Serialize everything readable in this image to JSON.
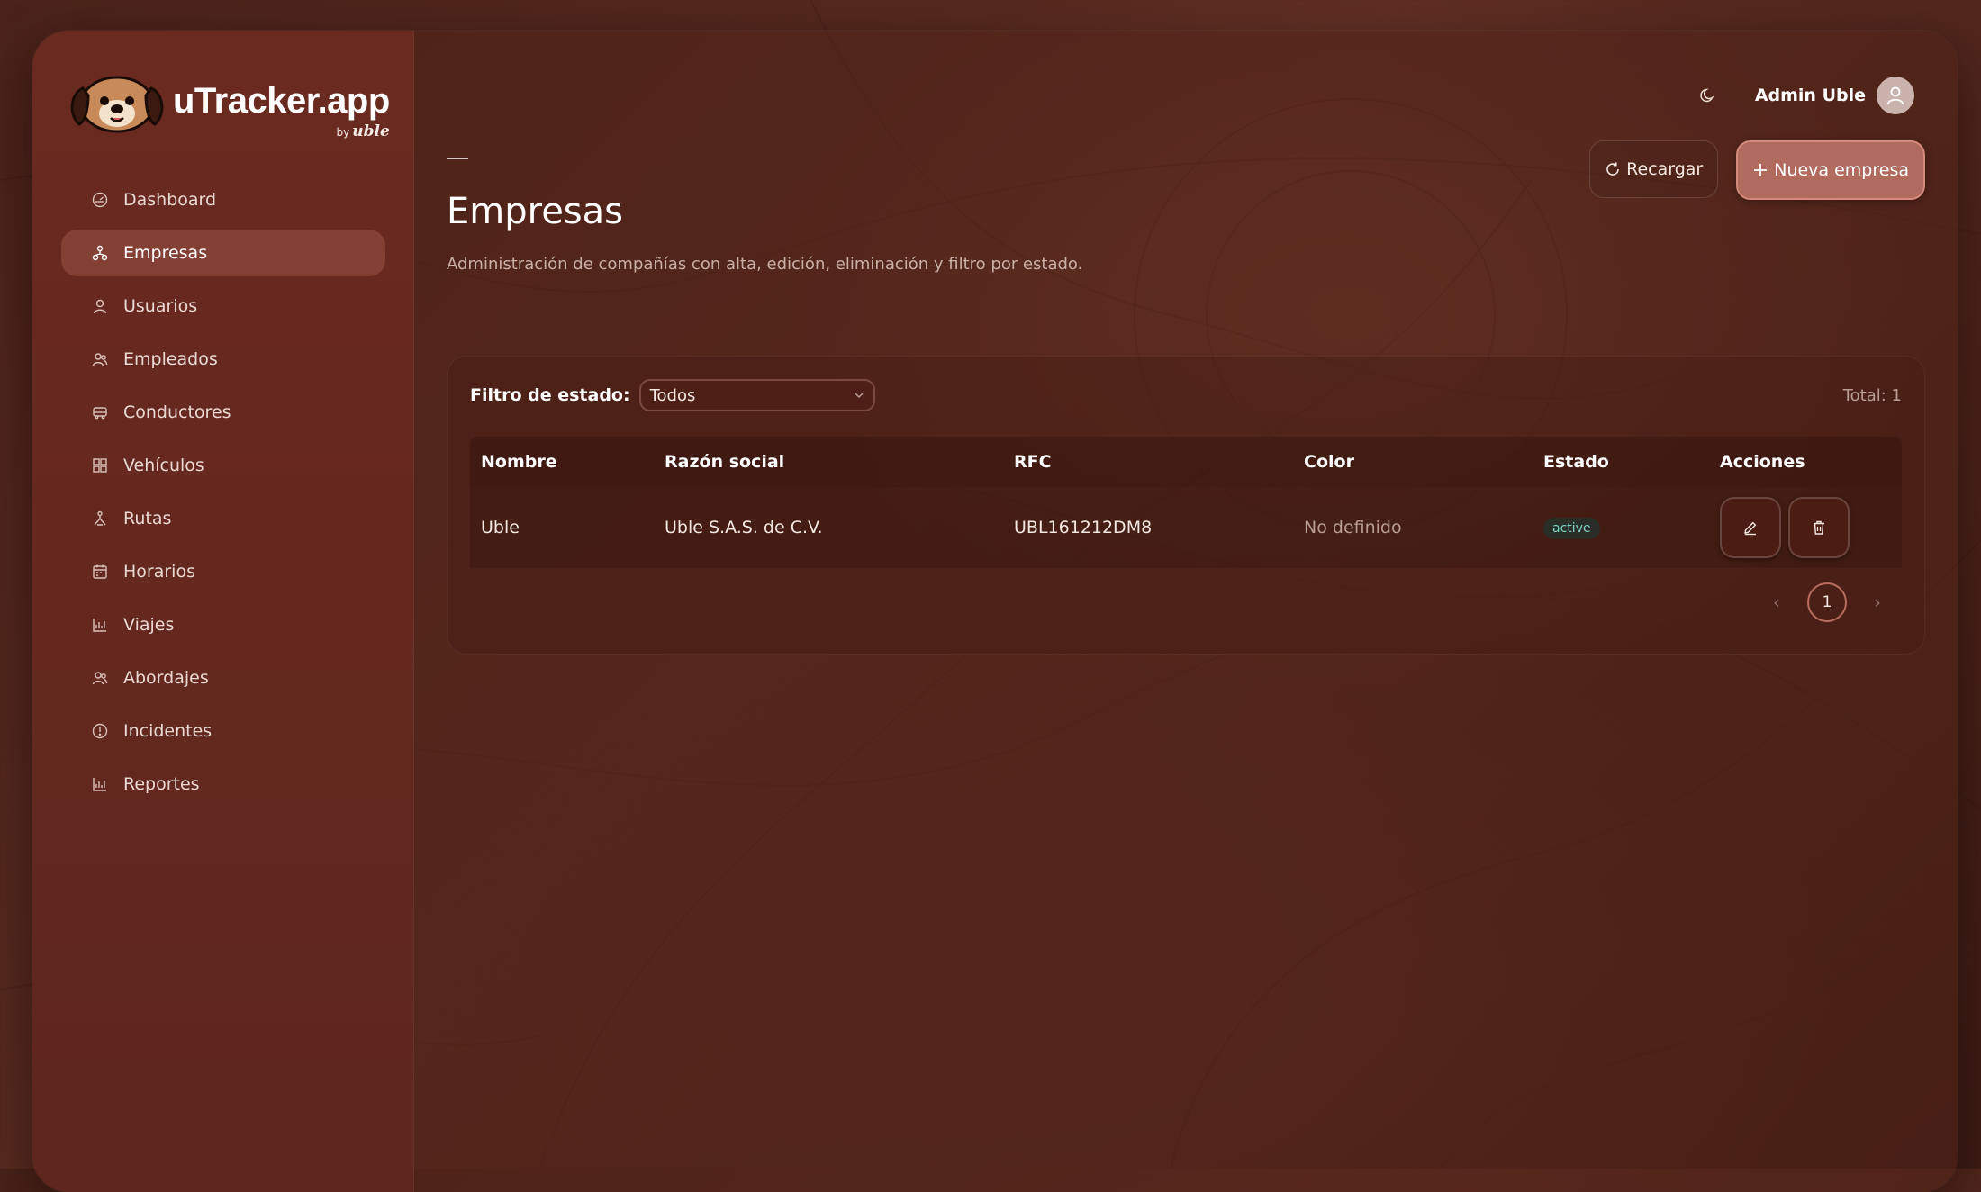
{
  "brand": {
    "name": "uTracker.app",
    "by": "by",
    "by_brand": "uble"
  },
  "header": {
    "user_name": "Admin Uble"
  },
  "sidebar": {
    "items": [
      {
        "label": "Dashboard",
        "icon": "dashboard-icon"
      },
      {
        "label": "Empresas",
        "icon": "buildings-icon",
        "active": true
      },
      {
        "label": "Usuarios",
        "icon": "user-icon"
      },
      {
        "label": "Empleados",
        "icon": "users-icon"
      },
      {
        "label": "Conductores",
        "icon": "car-icon"
      },
      {
        "label": "Vehículos",
        "icon": "grid-icon"
      },
      {
        "label": "Rutas",
        "icon": "route-icon"
      },
      {
        "label": "Horarios",
        "icon": "calendar-icon"
      },
      {
        "label": "Viajes",
        "icon": "chart-icon"
      },
      {
        "label": "Abordajes",
        "icon": "users-icon"
      },
      {
        "label": "Incidentes",
        "icon": "alert-icon"
      },
      {
        "label": "Reportes",
        "icon": "chart-icon"
      }
    ]
  },
  "page": {
    "title": "Empresas",
    "subtitle": "Administración de compañías con alta, edición, eliminación y filtro por estado.",
    "reload_label": "Recargar",
    "new_label": "Nueva empresa"
  },
  "filter": {
    "label": "Filtro de estado:",
    "selected": "Todos",
    "total": "Total: 1"
  },
  "table": {
    "columns": [
      "Nombre",
      "Razón social",
      "RFC",
      "Color",
      "Estado",
      "Acciones"
    ],
    "rows": [
      {
        "nombre": "Uble",
        "razon_social": "Uble S.A.S. de C.V.",
        "rfc": "UBL161212DM8",
        "color": "No definido",
        "estado": "active"
      }
    ]
  },
  "pagination": {
    "current": "1",
    "prev": "‹",
    "next": "›"
  },
  "colors": {
    "sidebar": "#6a2a20",
    "active_nav": "#8a4a3e",
    "primary_button": "#b06a5e",
    "badge_text": "#7fd3c9"
  }
}
